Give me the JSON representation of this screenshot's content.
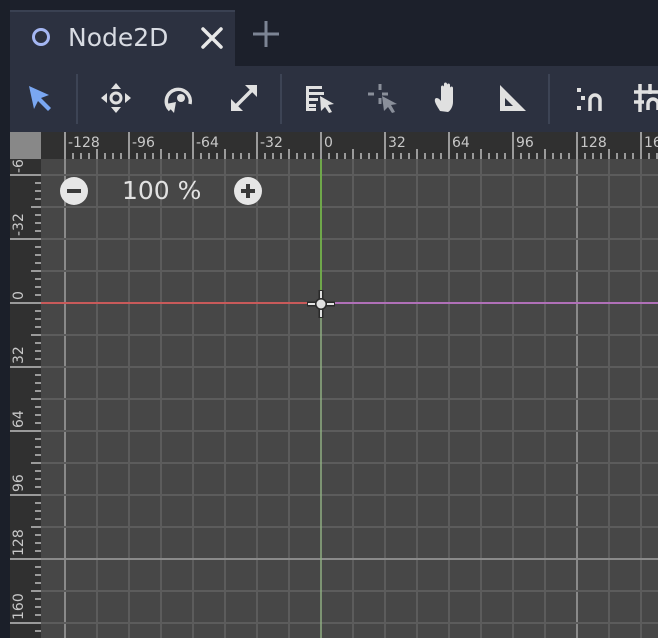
{
  "tab": {
    "title": "Node2D",
    "icon": "node2d-circle-icon"
  },
  "toolbar": {
    "tools": [
      {
        "name": "select-tool",
        "icon": "arrow-cursor-icon",
        "active": true
      },
      {
        "name": "move-tool",
        "icon": "move-arrows-icon"
      },
      {
        "name": "rotate-tool",
        "icon": "rotate-icon"
      },
      {
        "name": "scale-tool",
        "icon": "scale-icon"
      },
      {
        "name": "list-select-tool",
        "icon": "list-select-icon"
      },
      {
        "name": "pivot-tool",
        "icon": "pivot-icon"
      },
      {
        "name": "pan-tool",
        "icon": "hand-icon"
      },
      {
        "name": "ruler-tool",
        "icon": "ruler-triangle-icon"
      },
      {
        "name": "smart-snap-toggle",
        "icon": "smart-snap-icon"
      },
      {
        "name": "grid-snap-toggle",
        "icon": "grid-snap-icon"
      }
    ]
  },
  "viewport": {
    "zoom_label": "100 %",
    "hruler_labels": [
      "-128",
      "-96",
      "-64",
      "-32",
      "0",
      "32",
      "64",
      "96",
      "128",
      "16"
    ],
    "vruler_labels": [
      "-6",
      "-32",
      "0",
      "32",
      "64",
      "96",
      "128",
      "160"
    ],
    "colors": {
      "grid_bg": "#474747",
      "x_axis": "#c85a5a",
      "y_axis": "#6fa84a",
      "ruler_bg": "#303030",
      "accent": "#7aa7f2"
    }
  }
}
